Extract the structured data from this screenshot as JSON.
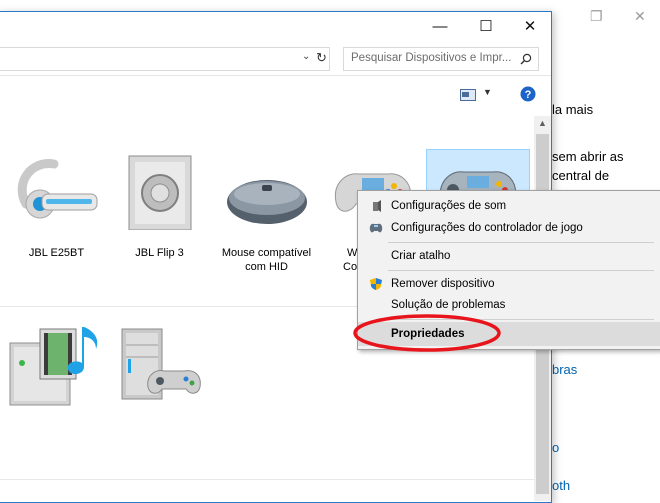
{
  "background_window": {
    "text_lines": [
      "la mais",
      "sem abrir as",
      "central de"
    ],
    "links": [
      "bras",
      "o",
      "oth"
    ]
  },
  "explorer": {
    "search": {
      "placeholder": "Pesquisar Dispositivos e Impr..."
    },
    "window_buttons": {
      "minimize": "—",
      "maximize": "☐",
      "close": "✕"
    }
  },
  "devices": [
    {
      "label": "JBL E25BT",
      "icon": "headset-icon"
    },
    {
      "label": "JBL Flip 3",
      "icon": "speaker-icon"
    },
    {
      "label": "Mouse compatível com HID",
      "icon": "mouse-icon"
    },
    {
      "label": "W",
      "icon": "gamepad-icon"
    },
    {
      "label": "",
      "icon": "gamepad-selected-icon"
    }
  ],
  "row2_devices": [
    {
      "label": "",
      "icon": "media-device-icon"
    },
    {
      "label": "",
      "icon": "pc-gamepad-icon"
    }
  ],
  "partial_labels": {
    "device4_line2": "Co"
  },
  "context_menu": {
    "items": [
      {
        "label": "Configurações de som",
        "icon": "speaker-small-icon"
      },
      {
        "label": "Configurações do controlador de jogo",
        "icon": "gamepad-small-icon"
      },
      {
        "label": "Criar atalho",
        "icon": ""
      },
      {
        "label": "Remover dispositivo",
        "icon": "uac-shield-icon"
      },
      {
        "label": "Solução de problemas",
        "icon": ""
      },
      {
        "label": "Propriedades",
        "icon": ""
      }
    ]
  },
  "colors": {
    "accent": "#2b79c6",
    "link": "#0063b1",
    "highlight": "#e8141c",
    "help": "#1d64c8"
  }
}
